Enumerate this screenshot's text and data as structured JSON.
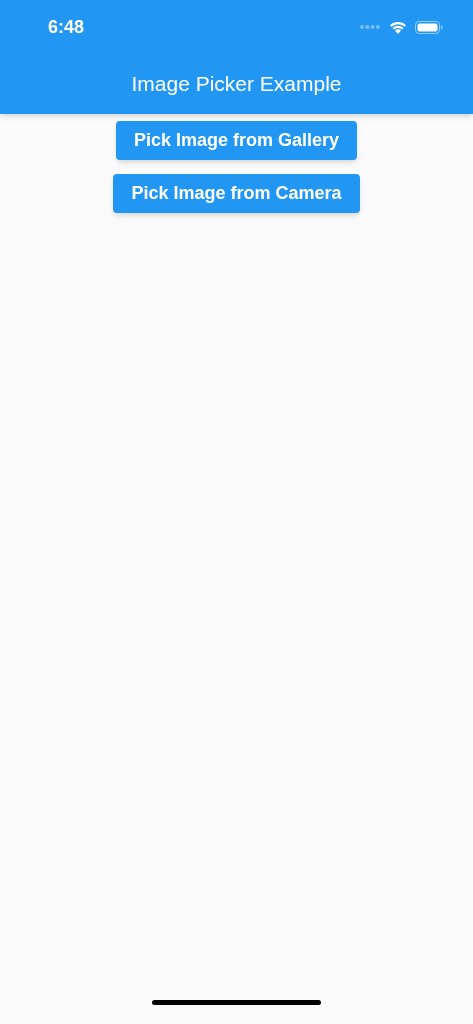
{
  "status_bar": {
    "time": "6:48"
  },
  "app_bar": {
    "title": "Image Picker Example"
  },
  "buttons": [
    "Pick Image from Gallery",
    "Pick Image from Camera"
  ]
}
